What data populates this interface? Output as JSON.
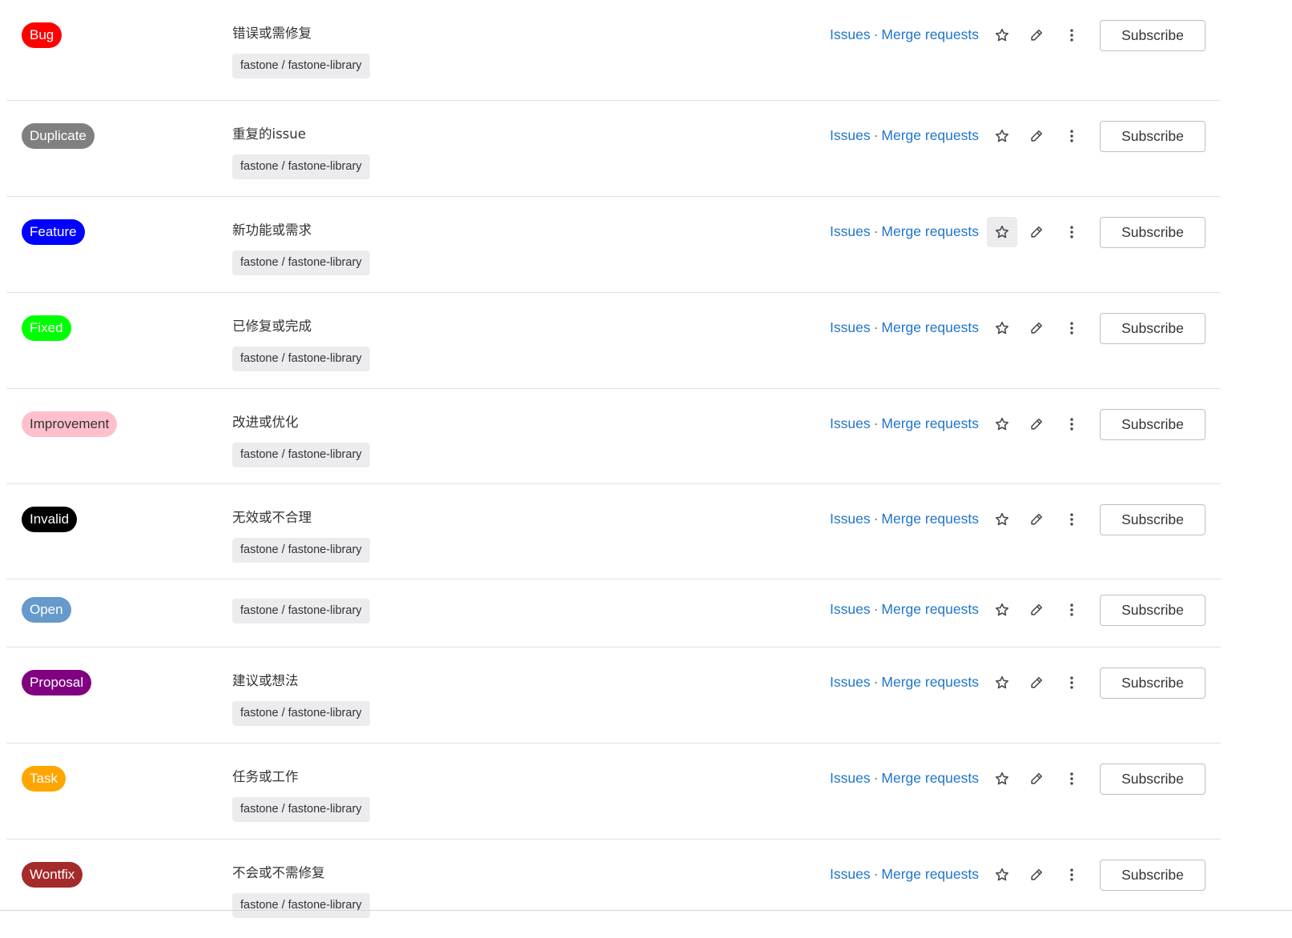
{
  "labels": [
    {
      "name": "Bug",
      "color": "#ff0000",
      "text_color": "#ffffff",
      "description": "错误或需修复",
      "project": "fastone / fastone-library"
    },
    {
      "name": "Duplicate",
      "color": "#808080",
      "text_color": "#ffffff",
      "description": "重复的issue",
      "project": "fastone / fastone-library"
    },
    {
      "name": "Feature",
      "color": "#0000ff",
      "text_color": "#ffffff",
      "description": "新功能或需求",
      "project": "fastone / fastone-library"
    },
    {
      "name": "Fixed",
      "color": "#00ff00",
      "text_color": "#ffffff",
      "description": "已修复或完成",
      "project": "fastone / fastone-library"
    },
    {
      "name": "Improvement",
      "color": "#ffc0cb",
      "text_color": "#333333",
      "description": "改进或优化",
      "project": "fastone / fastone-library"
    },
    {
      "name": "Invalid",
      "color": "#000000",
      "text_color": "#ffffff",
      "description": "无效或不合理",
      "project": "fastone / fastone-library"
    },
    {
      "name": "Open",
      "color": "#6699cc",
      "text_color": "#ffffff",
      "description": "",
      "project": "fastone / fastone-library"
    },
    {
      "name": "Proposal",
      "color": "#800080",
      "text_color": "#ffffff",
      "description": "建议或想法",
      "project": "fastone / fastone-library"
    },
    {
      "name": "Task",
      "color": "#ffa500",
      "text_color": "#ffffff",
      "description": "任务或工作",
      "project": "fastone / fastone-library"
    },
    {
      "name": "Wontfix",
      "color": "#a52a2a",
      "text_color": "#ffffff",
      "description": "不会或不需修复",
      "project": "fastone / fastone-library"
    }
  ],
  "row_actions": {
    "issues_link": "Issues",
    "separator": "·",
    "merge_requests_link": "Merge requests",
    "subscribe_label": "Subscribe"
  },
  "icons": {
    "star": "star-icon",
    "edit": "pencil-icon",
    "more": "vertical-ellipsis-icon"
  },
  "link_color": "#1f75cb",
  "hovered_star_row": 2
}
